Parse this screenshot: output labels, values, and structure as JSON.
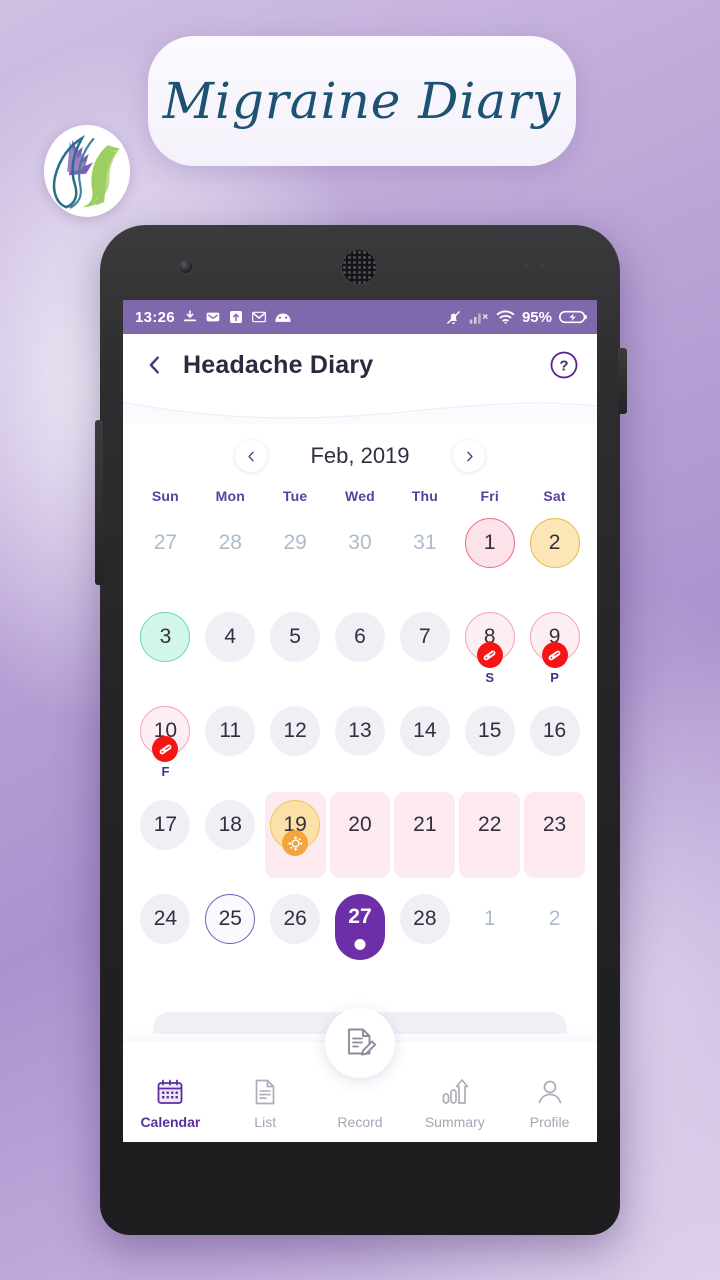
{
  "promo": {
    "title": "Migraine Diary",
    "logo_icon": "leaf-face-logo-icon"
  },
  "phone": {
    "camera_icon": "front-camera-icon",
    "speaker_icon": "earpiece-speaker-icon"
  },
  "status_bar": {
    "time": "13:26",
    "battery_percent": "95%",
    "left_icons": [
      "download-icon",
      "envelope-icon",
      "upload-icon",
      "gmail-icon",
      "android-app-icon"
    ],
    "right_icons": [
      "bell-muted-icon",
      "signal-bars-off-icon",
      "wifi-icon",
      "battery-charging-icon"
    ],
    "bg_color": "#7e69ad"
  },
  "app_bar": {
    "back_icon": "chevron-left-icon",
    "title": "Headache Diary",
    "help_icon": "help-circle-icon"
  },
  "calendar": {
    "prev_icon": "chevron-left-icon",
    "next_icon": "chevron-right-icon",
    "month_label": "Feb, 2019",
    "weekdays": [
      "Sun",
      "Mon",
      "Tue",
      "Wed",
      "Thu",
      "Fri",
      "Sat"
    ],
    "accent_color": "#5b3fa0",
    "selected_color": "#6d2fa8",
    "period_band_color": "#fdeaee",
    "rows": [
      [
        {
          "day": "27",
          "style": "muted"
        },
        {
          "day": "28",
          "style": "muted"
        },
        {
          "day": "29",
          "style": "muted"
        },
        {
          "day": "30",
          "style": "muted"
        },
        {
          "day": "31",
          "style": "muted"
        },
        {
          "day": "1",
          "style": "pink"
        },
        {
          "day": "2",
          "style": "amber"
        }
      ],
      [
        {
          "day": "3",
          "style": "mint"
        },
        {
          "day": "4",
          "style": "plain"
        },
        {
          "day": "5",
          "style": "plain"
        },
        {
          "day": "6",
          "style": "plain"
        },
        {
          "day": "7",
          "style": "plain"
        },
        {
          "day": "8",
          "style": "pinkfaint",
          "badge": "pill-icon",
          "badge_color": "red",
          "label": "S"
        },
        {
          "day": "9",
          "style": "pinkfaint",
          "badge": "pill-icon",
          "badge_color": "red",
          "label": "P"
        }
      ],
      [
        {
          "day": "10",
          "style": "pinkfaint",
          "badge": "pill-icon",
          "badge_color": "red",
          "label": "F"
        },
        {
          "day": "11",
          "style": "plain"
        },
        {
          "day": "12",
          "style": "plain"
        },
        {
          "day": "13",
          "style": "plain"
        },
        {
          "day": "14",
          "style": "plain"
        },
        {
          "day": "15",
          "style": "plain"
        },
        {
          "day": "16",
          "style": "plain"
        }
      ],
      [
        {
          "day": "17",
          "style": "plain"
        },
        {
          "day": "18",
          "style": "plain"
        },
        {
          "day": "19",
          "style": "amberfill",
          "band": true,
          "badge": "ovulation-icon",
          "badge_color": "orange"
        },
        {
          "day": "20",
          "style": "onband",
          "band": true
        },
        {
          "day": "21",
          "style": "onband",
          "band": true
        },
        {
          "day": "22",
          "style": "onband",
          "band": true
        },
        {
          "day": "23",
          "style": "onband",
          "band": true
        }
      ],
      [
        {
          "day": "24",
          "style": "plain"
        },
        {
          "day": "25",
          "style": "ring"
        },
        {
          "day": "26",
          "style": "plain"
        },
        {
          "day": "27",
          "style": "selected",
          "dot": true
        },
        {
          "day": "28",
          "style": "plain"
        },
        {
          "day": "1",
          "style": "muted"
        },
        {
          "day": "2",
          "style": "muted"
        }
      ]
    ]
  },
  "bottom_nav": {
    "items": [
      {
        "label": "Calendar",
        "icon": "calendar-icon",
        "active": true
      },
      {
        "label": "List",
        "icon": "list-document-icon",
        "active": false
      },
      {
        "label": "Summary",
        "icon": "bar-chart-icon",
        "active": false
      },
      {
        "label": "Profile",
        "icon": "person-icon",
        "active": false
      }
    ],
    "fab": {
      "label": "Record",
      "icon": "note-pencil-icon"
    }
  }
}
